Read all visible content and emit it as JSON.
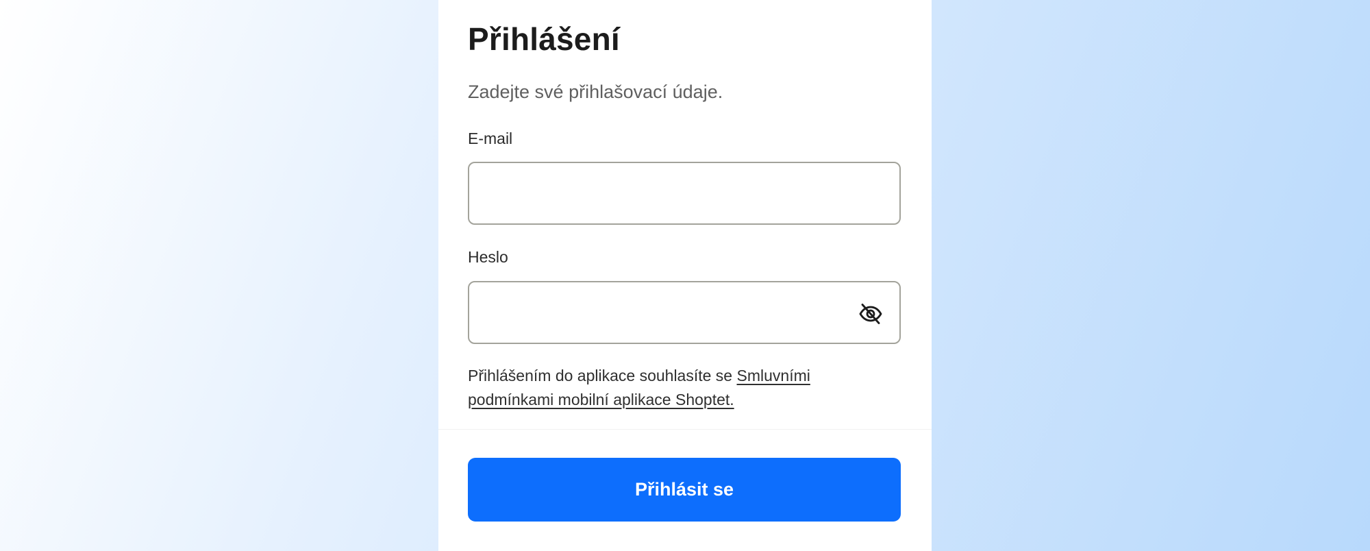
{
  "login": {
    "title": "Přihlášení",
    "subtitle": "Zadejte své přihlašovací údaje.",
    "email_label": "E-mail",
    "email_value": "",
    "password_label": "Heslo",
    "password_value": "",
    "password_toggle_icon": "eye-off-icon",
    "terms_text": "Přihlášením do aplikace souhlasíte se ",
    "terms_link": "Smluvními podmínkami mobilní aplikace Shoptet.",
    "submit_label": "Přihlásit se"
  },
  "colors": {
    "accent": "#0d6efd",
    "text": "#1c1c1c",
    "input_border": "#a3a39b"
  }
}
